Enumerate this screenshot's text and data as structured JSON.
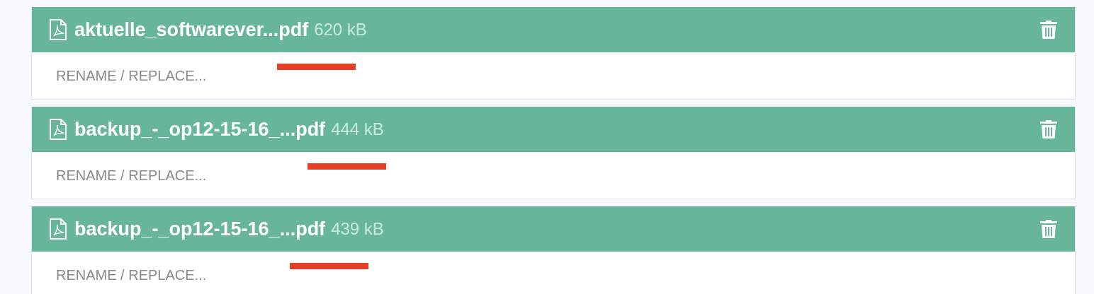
{
  "files": [
    {
      "name": "aktuelle_softwarever...pdf",
      "size": "620 kB",
      "action": "RENAME / REPLACE...",
      "marked": true
    },
    {
      "name": "backup_-_op12-15-16_...pdf",
      "size": "444 kB",
      "action": "RENAME / REPLACE...",
      "marked": true
    },
    {
      "name": "backup_-_op12-15-16_...pdf",
      "size": "439 kB",
      "action": "RENAME / REPLACE...",
      "marked": true
    }
  ]
}
